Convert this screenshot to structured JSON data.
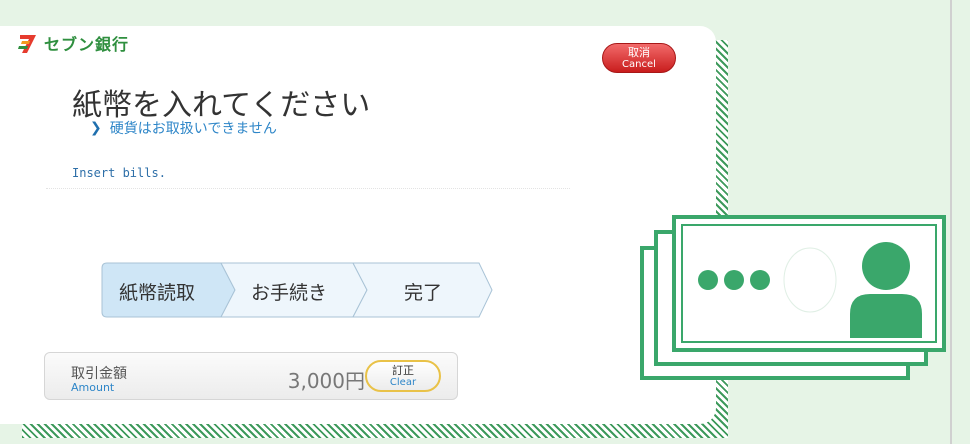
{
  "brand": {
    "name": "セブン銀行",
    "logo_mark": "7-logo-icon",
    "color": "#2f8f3f"
  },
  "header": {
    "cancel_label": "取消",
    "cancel_label_en": "Cancel"
  },
  "main": {
    "title": "紙幣を入れてください",
    "notice": "硬貨はお取扱いできません",
    "subtitle": "Insert bills."
  },
  "steps": [
    {
      "label": "紙幣読取",
      "active": true
    },
    {
      "label": "お手続き",
      "active": false
    },
    {
      "label": "完了",
      "active": false
    }
  ],
  "amount": {
    "label": "取引金額",
    "label_en": "Amount",
    "value": "3,000円",
    "clear_label": "訂正",
    "clear_label_en": "Clear"
  },
  "illustration": {
    "icon": "banknote-icon",
    "color": "#3aa76b"
  },
  "colors": {
    "accent": "#2e86c8",
    "cancel": "#d62828",
    "background": "#e6f4e6",
    "step_active": "#cfe6f6"
  }
}
